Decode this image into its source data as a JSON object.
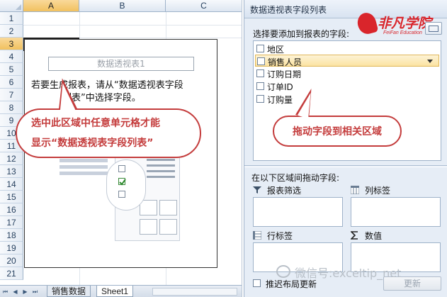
{
  "spreadsheet": {
    "columns": [
      "A",
      "B",
      "C"
    ],
    "rows": [
      "1",
      "2",
      "3",
      "4",
      "5",
      "6",
      "7",
      "8",
      "9",
      "10",
      "11",
      "12",
      "13",
      "14",
      "15",
      "16",
      "17",
      "18",
      "19",
      "20",
      "21"
    ],
    "selected_cell": "A3",
    "pivot_table_name": "数据透视表1",
    "instruction_lines": [
      "若要生成报表，请从“数据透视表字段",
      "列表”中选择字段。"
    ],
    "callout_lines": [
      "选中此区域中任意单元格才能",
      "显示“数据透视表字段列表”"
    ],
    "tabs": [
      "销售数据",
      "Sheet1"
    ],
    "active_tab": "Sheet1"
  },
  "field_list": {
    "title": "数据透视表字段列表",
    "choose_label": "选择要添加到报表的字段:",
    "fields": [
      {
        "label": "地区",
        "checked": false,
        "highlighted": false
      },
      {
        "label": "销售人员",
        "checked": false,
        "highlighted": true
      },
      {
        "label": "订购日期",
        "checked": false,
        "highlighted": false
      },
      {
        "label": "订单ID",
        "checked": false,
        "highlighted": false
      },
      {
        "label": "订购量",
        "checked": false,
        "highlighted": false
      }
    ],
    "callout": "拖动字段到相关区域",
    "drag_label": "在以下区域间拖动字段:",
    "areas": [
      {
        "label": "报表筛选",
        "icon": "filter-icon"
      },
      {
        "label": "列标签",
        "icon": "column-labels-icon"
      },
      {
        "label": "行标签",
        "icon": "row-labels-icon"
      },
      {
        "label": "数值",
        "icon": "sigma-icon"
      }
    ],
    "defer_label": "推迟布局更新",
    "update_button": "更新"
  },
  "logo": {
    "name": "非凡学院",
    "sub": "FeiFan Education",
    "color": "#d9252b"
  },
  "watermark": "微信号:exceltip_net",
  "colors": {
    "callout_red": "#c43c3c",
    "header_selected": "#f1c15f",
    "pane_background": "#e6edf6"
  }
}
